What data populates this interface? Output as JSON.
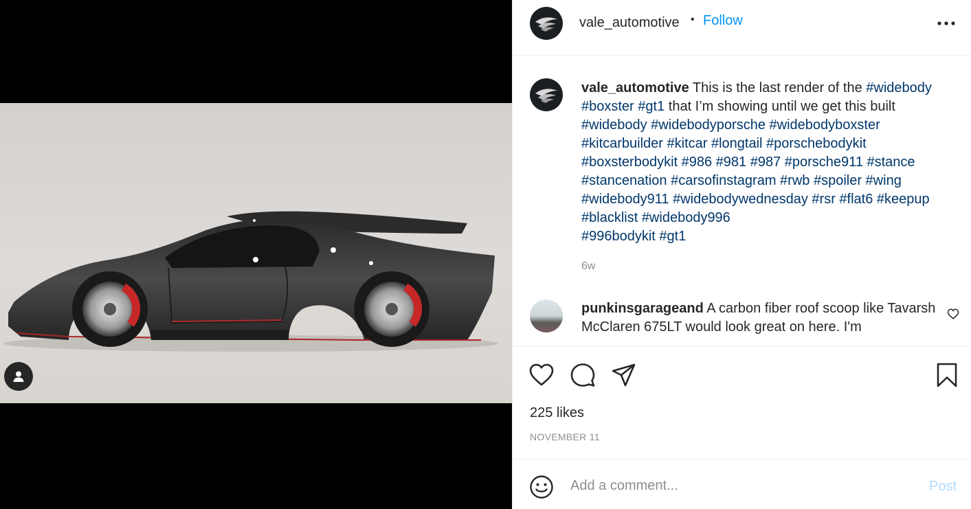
{
  "post": {
    "author": "vale_automotive",
    "separator": "•",
    "follow_label": "Follow",
    "more_icon": "more-horizontal-icon"
  },
  "caption": {
    "username": "vale_automotive",
    "text": " This is the last render of the ",
    "lines": [
      "#widebody",
      "#boxster #gt1",
      " that I’m showing until we get this built",
      "#widebody #widebodyporsche #widebodyboxster",
      "#kitcarbuilder #kitcar #longtail #porschebodykit",
      "#boxsterbodykit #986 #981 #987 #porsche911 #stance",
      "#stancenation #carsofinstagram #rwb #spoiler #wing",
      "#widebody911 #widebodywednesday #rsr #flat6 #keepup",
      "#blacklist #widebody996",
      "#996bodykit #gt1"
    ],
    "age": "6w"
  },
  "comments": [
    {
      "username": "punkinsgarageand",
      "text": " A carbon fiber roof scoop like Tavarsh McClaren 675LT would look great on here. I'm"
    }
  ],
  "actions": {
    "like_icon": "heart-icon",
    "comment_icon": "comment-icon",
    "share_icon": "paper-plane-icon",
    "save_icon": "bookmark-icon",
    "likes": "225 likes",
    "date": "NOVEMBER 11"
  },
  "add_comment": {
    "placeholder": "Add a comment...",
    "post_label": "Post",
    "emoji_icon": "smiley-icon"
  },
  "colors": {
    "link": "#00376b",
    "follow": "#0095f6",
    "post_disabled": "#b3dbff",
    "muted": "#8e8e8e"
  }
}
